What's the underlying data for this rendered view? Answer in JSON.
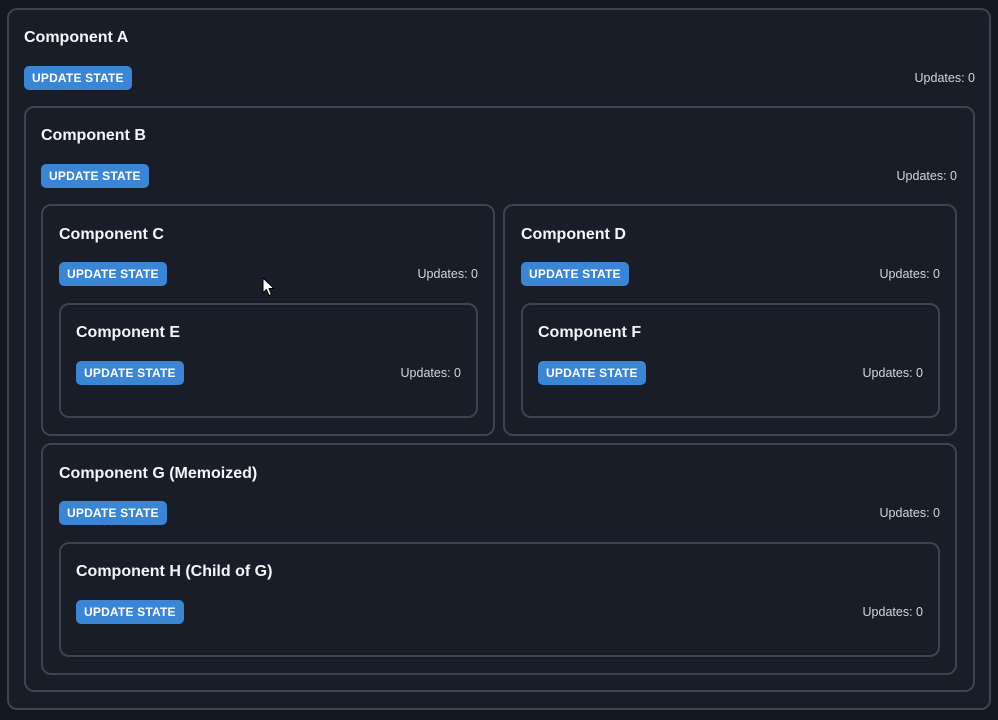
{
  "button_label": "UPDATE STATE",
  "colors": {
    "background": "#141821",
    "panel_border": "#3d4450",
    "button": "#3b86d4",
    "text": "#f5f6f8"
  },
  "components": {
    "a": {
      "title": "Component A",
      "updates": "Updates: 0"
    },
    "b": {
      "title": "Component B",
      "updates": "Updates: 0"
    },
    "c": {
      "title": "Component C",
      "updates": "Updates: 0"
    },
    "d": {
      "title": "Component D",
      "updates": "Updates: 0"
    },
    "e": {
      "title": "Component E",
      "updates": "Updates: 0"
    },
    "f": {
      "title": "Component F",
      "updates": "Updates: 0"
    },
    "g": {
      "title": "Component G (Memoized)",
      "updates": "Updates: 0"
    },
    "h": {
      "title": "Component H (Child of G)",
      "updates": "Updates: 0"
    }
  }
}
